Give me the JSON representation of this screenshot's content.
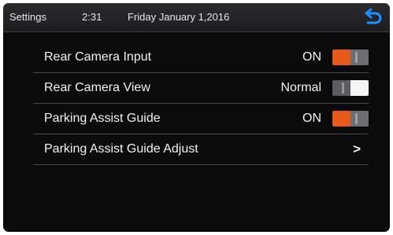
{
  "header": {
    "title": "Settings",
    "time": "2:31",
    "date": "Friday January 1,2016",
    "back_icon": "back-arrow-icon",
    "accent_color": "#1e90ff"
  },
  "rows": [
    {
      "label": "Rear Camera Input",
      "value": "ON",
      "control": "toggle",
      "state": "on"
    },
    {
      "label": "Rear Camera View",
      "value": "Normal",
      "control": "toggle",
      "state": "off"
    },
    {
      "label": "Parking Assist Guide",
      "value": "ON",
      "control": "toggle",
      "state": "on"
    },
    {
      "label": "Parking Assist Guide Adjust",
      "value": ">",
      "control": "chevron"
    }
  ],
  "colors": {
    "toggle_on": "#e85a1a",
    "toggle_off": "#f5f5f5",
    "background": "#0b0b0c"
  }
}
